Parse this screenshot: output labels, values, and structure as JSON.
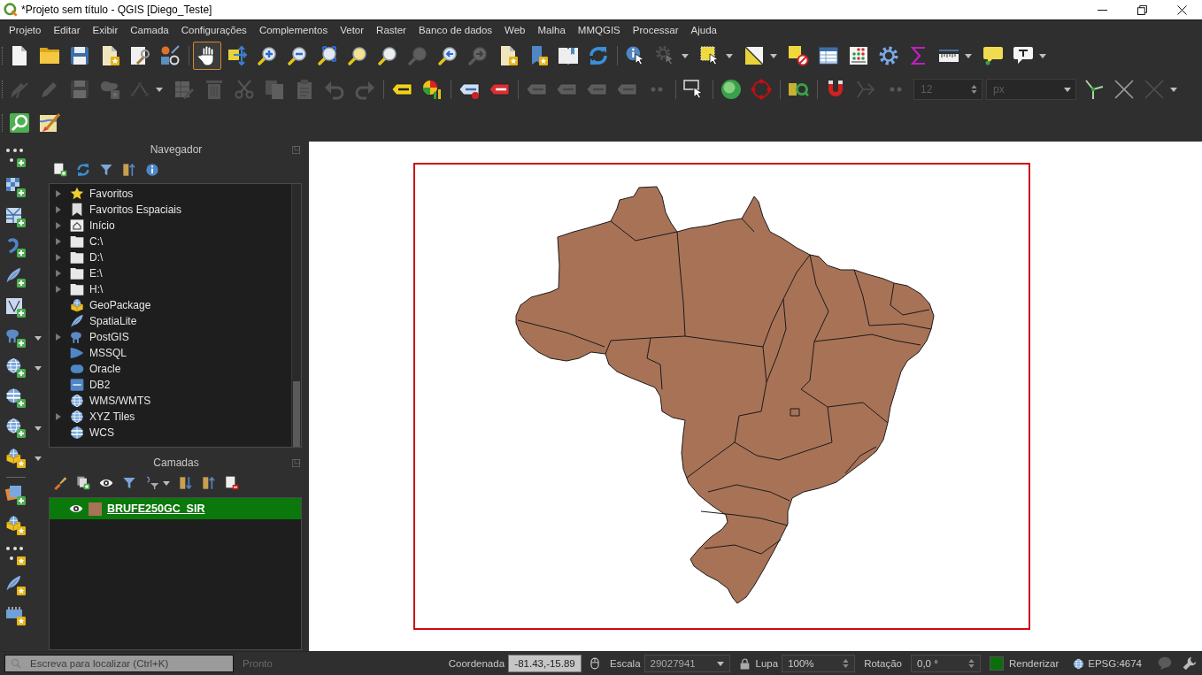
{
  "window": {
    "title": "*Projeto sem título - QGIS [Diego_Teste]"
  },
  "menu": [
    "Projeto",
    "Editar",
    "Exibir",
    "Camada",
    "Configurações",
    "Complementos",
    "Vetor",
    "Raster",
    "Banco de dados",
    "Web",
    "Malha",
    "MMQGIS",
    "Processar",
    "Ajuda"
  ],
  "toolbars": [
    {
      "items": [
        {
          "kind": "button",
          "disabled": false,
          "selected": false,
          "dropdown": false
        },
        {
          "kind": "button",
          "disabled": false,
          "selected": false,
          "dropdown": false
        },
        {
          "kind": "button",
          "disabled": false,
          "selected": false,
          "dropdown": false
        },
        {
          "kind": "button",
          "disabled": false,
          "selected": false,
          "dropdown": false
        },
        {
          "kind": "button",
          "disabled": false,
          "selected": false,
          "dropdown": false
        },
        {
          "kind": "button",
          "disabled": false,
          "selected": false,
          "dropdown": false
        },
        {
          "kind": "separator"
        },
        {
          "kind": "button",
          "disabled": false,
          "selected": true,
          "dropdown": false
        },
        {
          "kind": "button",
          "disabled": false,
          "selected": false,
          "dropdown": false
        },
        {
          "kind": "button",
          "disabled": false,
          "selected": false,
          "dropdown": false
        },
        {
          "kind": "button",
          "disabled": false,
          "selected": false,
          "dropdown": false
        },
        {
          "kind": "button",
          "disabled": false,
          "selected": false,
          "dropdown": false
        },
        {
          "kind": "button",
          "disabled": false,
          "selected": false,
          "dropdown": false
        },
        {
          "kind": "button",
          "disabled": false,
          "selected": false,
          "dropdown": false
        },
        {
          "kind": "button",
          "disabled": true,
          "selected": false,
          "dropdown": false
        },
        {
          "kind": "button",
          "disabled": false,
          "selected": false,
          "dropdown": false
        },
        {
          "kind": "button",
          "disabled": true,
          "selected": false,
          "dropdown": false
        },
        {
          "kind": "button",
          "disabled": false,
          "selected": false,
          "dropdown": false
        },
        {
          "kind": "button",
          "disabled": false,
          "selected": false,
          "dropdown": false
        },
        {
          "kind": "button",
          "disabled": false,
          "selected": false,
          "dropdown": false
        },
        {
          "kind": "button",
          "disabled": false,
          "selected": false,
          "dropdown": false
        },
        {
          "kind": "separator"
        },
        {
          "kind": "button",
          "disabled": false,
          "selected": false,
          "dropdown": false
        },
        {
          "kind": "button",
          "disabled": true,
          "selected": false,
          "dropdown": true
        },
        {
          "kind": "button",
          "disabled": false,
          "selected": false,
          "dropdown": true
        },
        {
          "kind": "button",
          "disabled": false,
          "selected": false,
          "dropdown": true
        },
        {
          "kind": "button",
          "disabled": false,
          "selected": false,
          "dropdown": false
        },
        {
          "kind": "button",
          "disabled": false,
          "selected": false,
          "dropdown": false
        },
        {
          "kind": "button",
          "disabled": false,
          "selected": false,
          "dropdown": false
        },
        {
          "kind": "button",
          "disabled": false,
          "selected": false,
          "dropdown": false
        },
        {
          "kind": "button",
          "disabled": false,
          "selected": false,
          "dropdown": false
        },
        {
          "kind": "button",
          "disabled": false,
          "selected": false,
          "dropdown": true
        },
        {
          "kind": "button",
          "disabled": false,
          "selected": false,
          "dropdown": false
        },
        {
          "kind": "button",
          "disabled": false,
          "selected": false,
          "dropdown": true
        }
      ]
    },
    {
      "items": [
        {
          "kind": "button",
          "disabled": true,
          "dropdown": false
        },
        {
          "kind": "button",
          "disabled": true,
          "dropdown": false
        },
        {
          "kind": "button",
          "disabled": true,
          "dropdown": false
        },
        {
          "kind": "button",
          "disabled": true,
          "dropdown": false
        },
        {
          "kind": "button",
          "disabled": true,
          "dropdown": true
        },
        {
          "kind": "button",
          "disabled": true,
          "dropdown": false
        },
        {
          "kind": "button",
          "disabled": true,
          "dropdown": false
        },
        {
          "kind": "button",
          "disabled": true,
          "dropdown": false
        },
        {
          "kind": "button",
          "disabled": true,
          "dropdown": false
        },
        {
          "kind": "button",
          "disabled": true,
          "dropdown": false
        },
        {
          "kind": "button",
          "disabled": true,
          "dropdown": false
        },
        {
          "kind": "button",
          "disabled": true,
          "dropdown": false
        },
        {
          "kind": "separator"
        },
        {
          "kind": "button",
          "disabled": false,
          "dropdown": false
        },
        {
          "kind": "button",
          "disabled": false,
          "dropdown": false
        },
        {
          "kind": "separator"
        },
        {
          "kind": "button",
          "disabled": false,
          "dropdown": false
        },
        {
          "kind": "button",
          "disabled": false,
          "dropdown": false
        },
        {
          "kind": "separator"
        },
        {
          "kind": "button",
          "disabled": true,
          "dropdown": false
        },
        {
          "kind": "button",
          "disabled": true,
          "dropdown": false
        },
        {
          "kind": "button",
          "disabled": true,
          "dropdown": false
        },
        {
          "kind": "button",
          "disabled": true,
          "dropdown": false
        },
        {
          "kind": "button",
          "disabled": true,
          "dropdown": false
        },
        {
          "kind": "separator"
        },
        {
          "kind": "button",
          "disabled": false,
          "dropdown": false
        },
        {
          "kind": "separator"
        },
        {
          "kind": "button",
          "disabled": false,
          "dropdown": false
        },
        {
          "kind": "button",
          "disabled": false,
          "dropdown": false
        },
        {
          "kind": "separator"
        },
        {
          "kind": "button",
          "disabled": false,
          "dropdown": false
        },
        {
          "kind": "separator"
        },
        {
          "kind": "button",
          "disabled": false,
          "dropdown": false
        },
        {
          "kind": "button",
          "disabled": true,
          "dropdown": false
        },
        {
          "kind": "button",
          "disabled": true,
          "dropdown": false
        },
        {
          "kind": "spinbox",
          "value": "12",
          "disabled": true
        },
        {
          "kind": "combo",
          "value": "px",
          "disabled": true
        },
        {
          "kind": "button",
          "disabled": false,
          "dropdown": false
        },
        {
          "kind": "button",
          "disabled": false,
          "dropdown": false
        },
        {
          "kind": "button",
          "disabled": true,
          "dropdown": true
        }
      ]
    },
    {
      "items": [
        {
          "kind": "button",
          "disabled": false,
          "dropdown": false
        },
        {
          "kind": "button",
          "disabled": false,
          "dropdown": false
        }
      ]
    }
  ],
  "side_toolbar": {
    "items": [
      {
        "kind": "button",
        "dropdown": false
      },
      {
        "kind": "button",
        "dropdown": false
      },
      {
        "kind": "button",
        "dropdown": false
      },
      {
        "kind": "button",
        "dropdown": false
      },
      {
        "kind": "button",
        "dropdown": false
      },
      {
        "kind": "button",
        "dropdown": false
      },
      {
        "kind": "button",
        "dropdown": true
      },
      {
        "kind": "button",
        "dropdown": true
      },
      {
        "kind": "button",
        "dropdown": false
      },
      {
        "kind": "button",
        "dropdown": true
      },
      {
        "kind": "button",
        "dropdown": true
      },
      {
        "kind": "separator"
      },
      {
        "kind": "button",
        "dropdown": false
      },
      {
        "kind": "button",
        "dropdown": false
      },
      {
        "kind": "button",
        "dropdown": false
      },
      {
        "kind": "button",
        "dropdown": false
      },
      {
        "kind": "button",
        "dropdown": false
      }
    ]
  },
  "browser_panel": {
    "title": "Navegador",
    "items": [
      {
        "label": "Favoritos",
        "expandable": true
      },
      {
        "label": "Favoritos Espaciais",
        "expandable": true
      },
      {
        "label": "Início",
        "expandable": true
      },
      {
        "label": "C:\\",
        "expandable": true
      },
      {
        "label": "D:\\",
        "expandable": true
      },
      {
        "label": "E:\\",
        "expandable": true
      },
      {
        "label": "H:\\",
        "expandable": true
      },
      {
        "label": "GeoPackage",
        "expandable": false
      },
      {
        "label": "SpatiaLite",
        "expandable": false
      },
      {
        "label": "PostGIS",
        "expandable": true
      },
      {
        "label": "MSSQL",
        "expandable": false
      },
      {
        "label": "Oracle",
        "expandable": false
      },
      {
        "label": "DB2",
        "expandable": false
      },
      {
        "label": "WMS/WMTS",
        "expandable": false
      },
      {
        "label": "XYZ Tiles",
        "expandable": true
      },
      {
        "label": "WCS",
        "expandable": false
      }
    ]
  },
  "layers_panel": {
    "title": "Camadas",
    "layers": [
      {
        "name": "BRUFE250GC_SIR",
        "visible": true,
        "selected": true,
        "color": "#a87257"
      }
    ]
  },
  "status_bar": {
    "search": {
      "placeholder": "Escreva para localizar (Ctrl+K)"
    },
    "message": "Pronto",
    "coordinate": {
      "label": "Coordenada",
      "value": "-81.43,-15.89"
    },
    "scale": {
      "label": "Escala",
      "value": "29027941"
    },
    "magnifier": {
      "label": "Lupa",
      "value": "100%"
    },
    "rotation": {
      "label": "Rotação",
      "value": "0,0 °"
    },
    "render": {
      "label": "Renderizar",
      "checked": true
    },
    "crs": "EPSG:4674"
  }
}
